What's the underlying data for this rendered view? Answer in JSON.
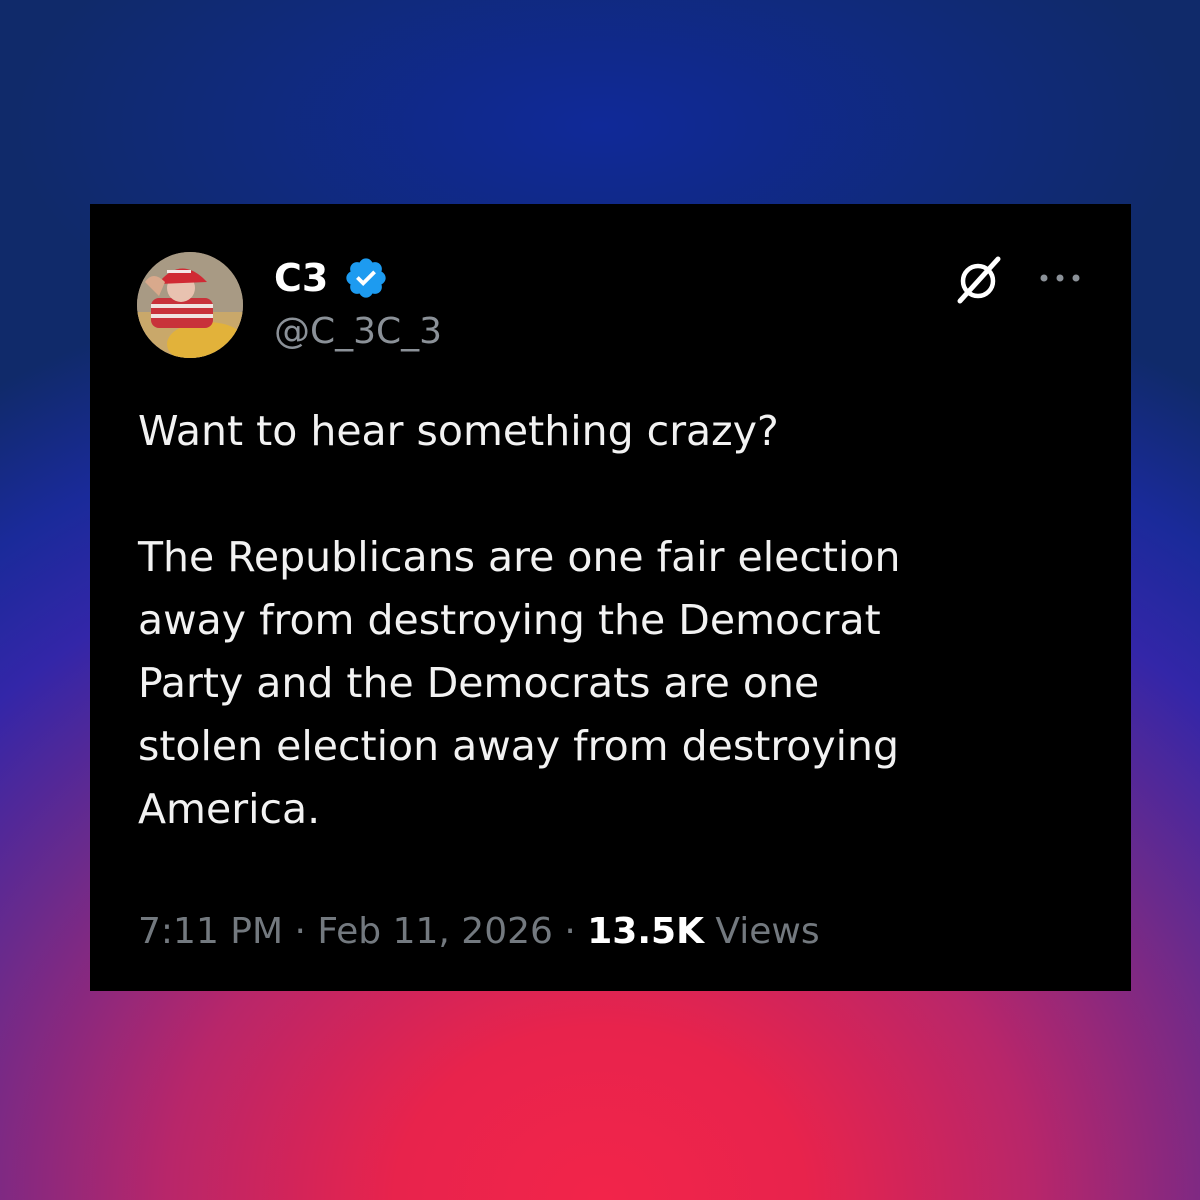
{
  "tweet": {
    "display_name": "C3",
    "handle": "@C_3C_3",
    "text_line_1": "Want to hear something crazy?",
    "text_body": "The Republicans are one fair election\naway from destroying the Democrat\nParty and the Democrats are one\nstolen election away from destroying\nAmerica.",
    "time": "7:11 PM",
    "separator_1": " · ",
    "date": "Feb 11, 2026",
    "separator_2": " · ",
    "views_count": "13.5K",
    "views_label": " Views"
  },
  "icons": {
    "verified": "verified-badge-icon",
    "grok": "grok-icon",
    "more": "more-options-icon"
  },
  "colors": {
    "card_background": "#000000",
    "verified_blue": "#1d9bf0",
    "text_primary": "#f2f2f2",
    "text_secondary": "#73797f",
    "backdrop_top": "#102a6a",
    "backdrop_bottom": "#f2244a"
  }
}
